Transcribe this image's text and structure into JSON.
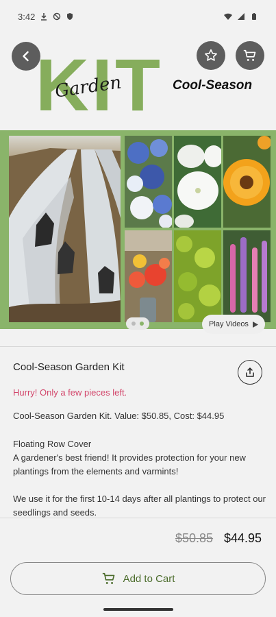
{
  "status_bar": {
    "time": "3:42",
    "icons": [
      "download-icon",
      "no-disturb-icon",
      "shield-icon",
      "wifi-icon",
      "signal-icon",
      "battery-icon"
    ]
  },
  "banner": {
    "kit": "KIT",
    "garden": "Garden",
    "season": "Cool-Season",
    "kit_color": "#86ad5c"
  },
  "gallery": {
    "play_label": "Play Videos",
    "page_count": 2,
    "active_page": 2,
    "frame_color": "#8ab46a"
  },
  "product": {
    "title": "Cool-Season Garden Kit",
    "stock_notice": "Hurry! Only a few pieces left.",
    "summary": "Cool-Season Garden Kit. Value: $50.85, Cost: $44.95",
    "desc_heading": "Floating Row Cover",
    "desc_body": "A gardener's best friend! It provides protection for your new plantings from the elements and varmints!",
    "desc_usage": "We use it for the first 10-14 days after all plantings to protect our seedlings and seeds."
  },
  "pricing": {
    "old_price": "$50.85",
    "new_price": "$44.95"
  },
  "actions": {
    "add_to_cart": "Add to Cart",
    "accent_color": "#4a6b2a"
  }
}
